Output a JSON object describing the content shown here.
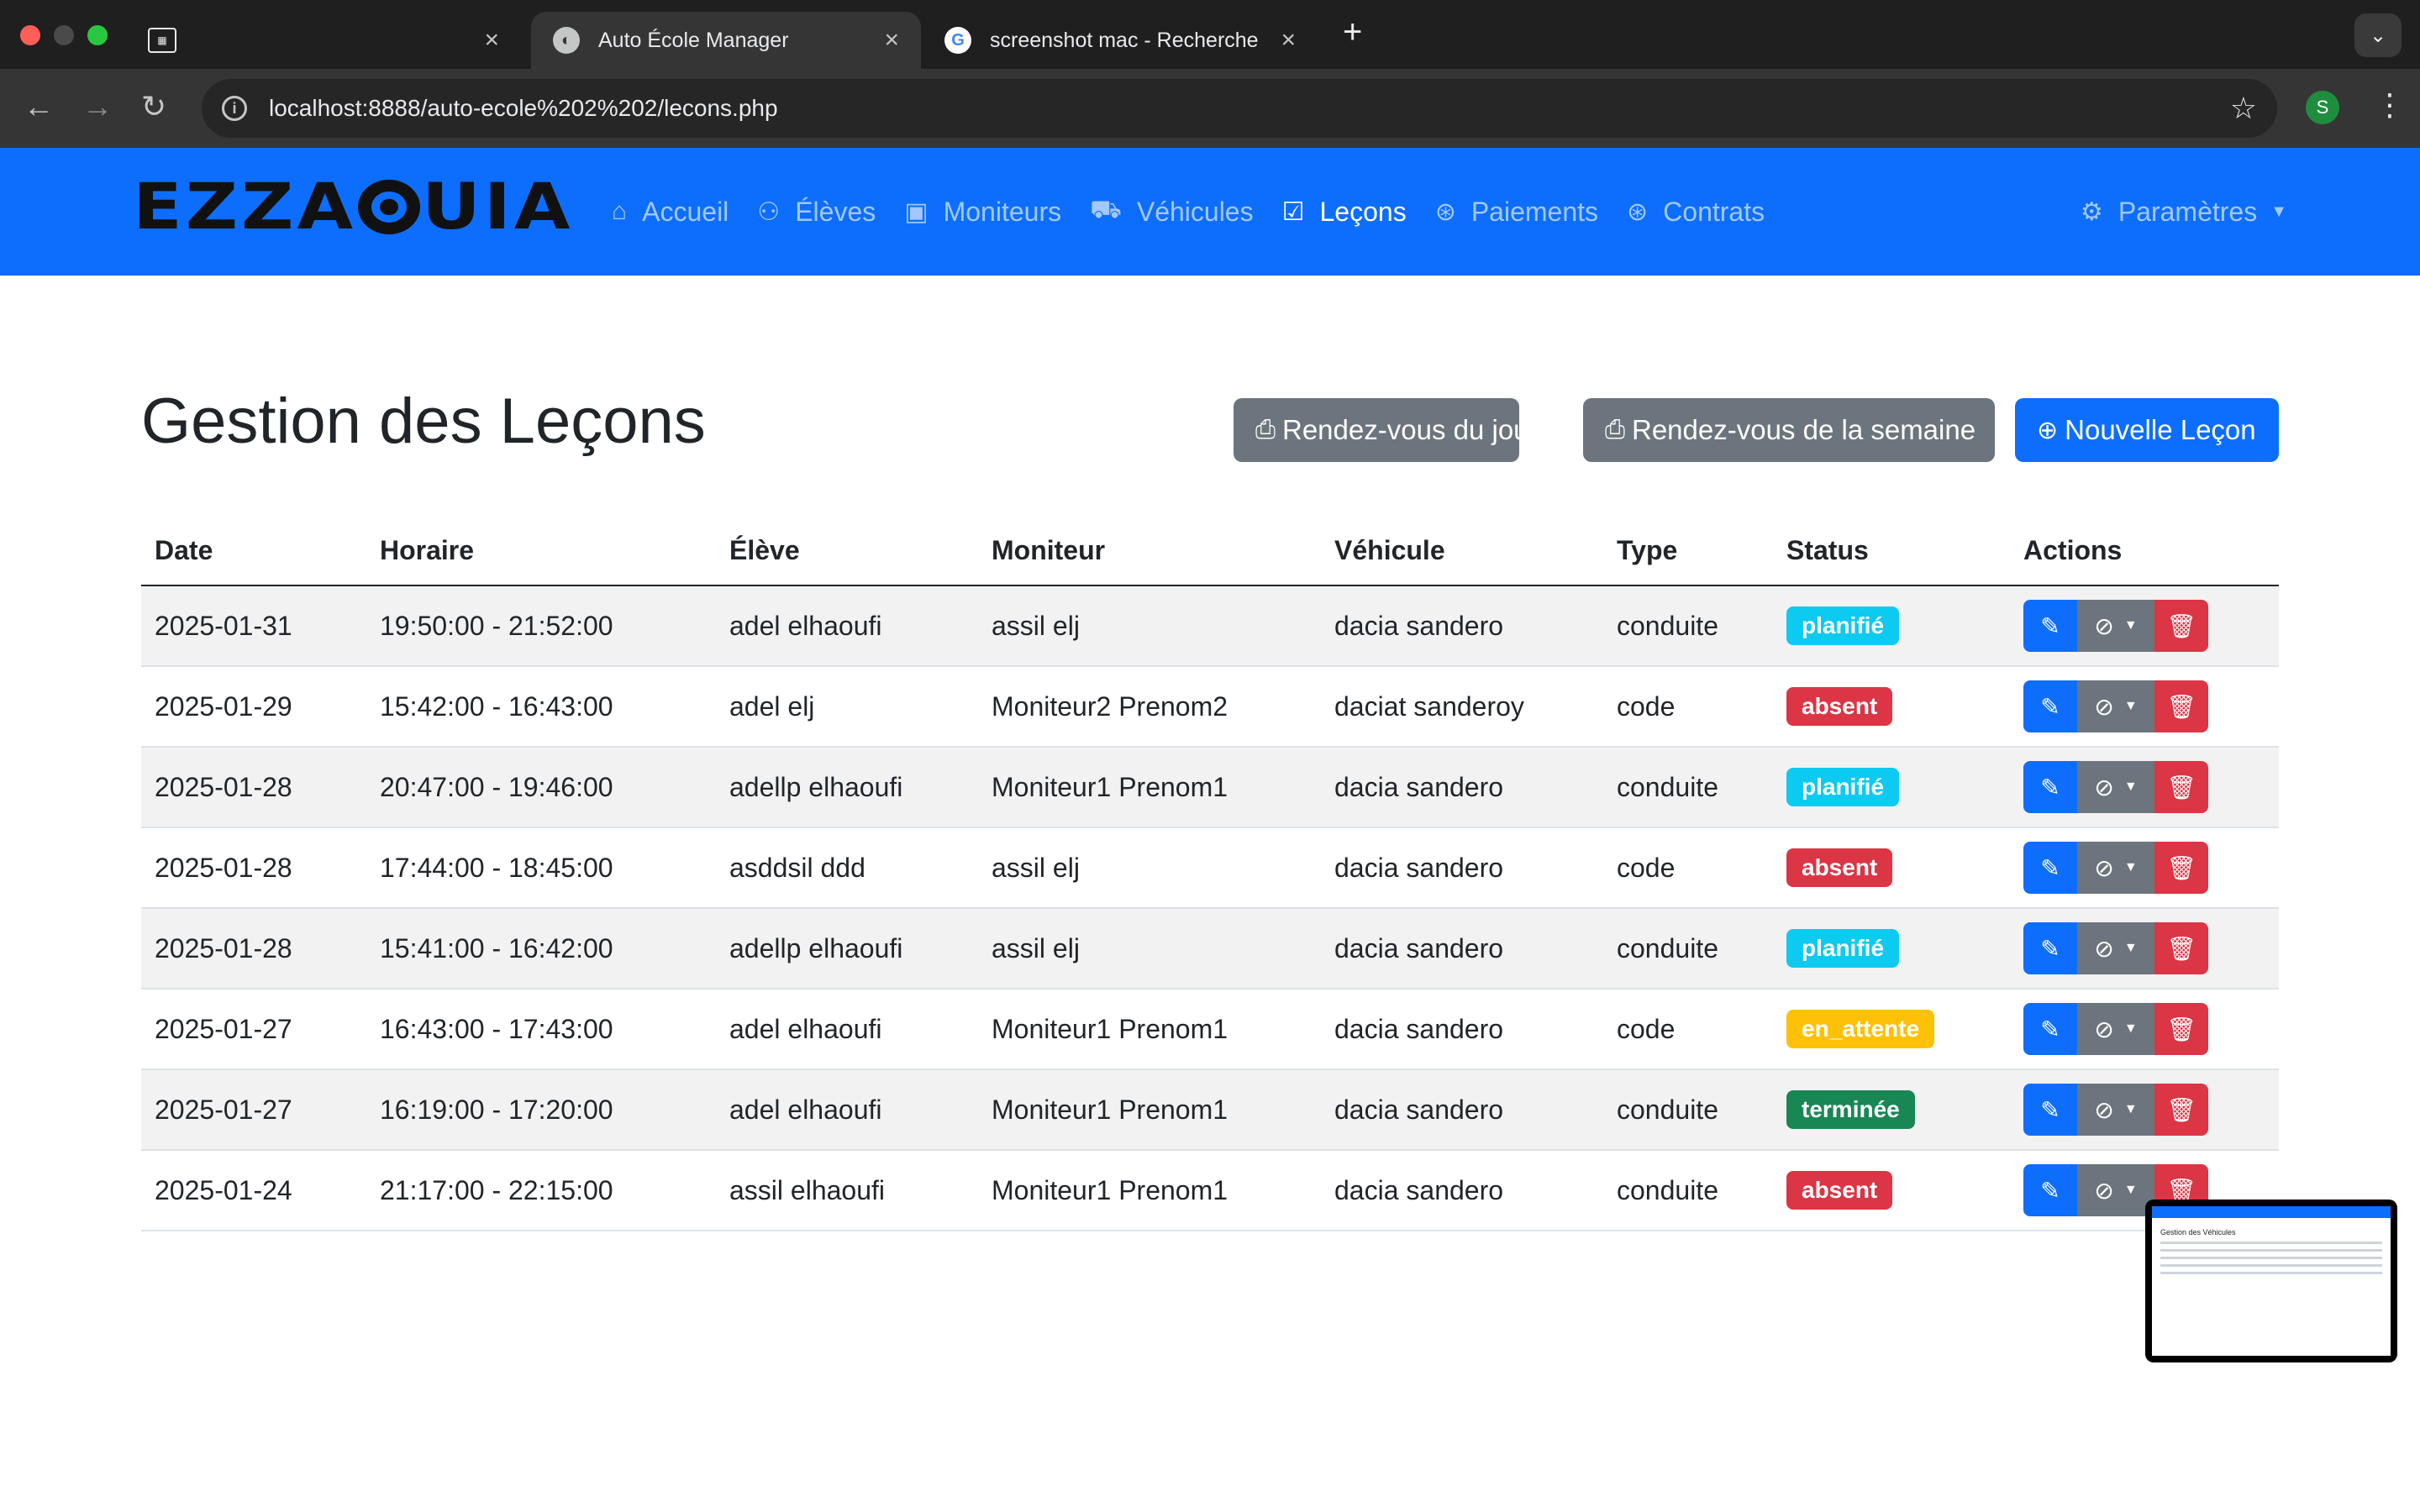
{
  "browser": {
    "tabs": [
      {
        "title": "",
        "icon": "app-icon"
      },
      {
        "title": "Auto École Manager",
        "icon": "app-favicon"
      },
      {
        "title": "screenshot mac - Recherche",
        "icon": "google-icon"
      }
    ],
    "url": "localhost:8888/auto-ecole%202%202/lecons.php",
    "profile_initial": "S"
  },
  "navbar": {
    "brand_left": "EZZA",
    "brand_right": "UIA",
    "items": [
      {
        "label": "Accueil",
        "icon": "home-icon"
      },
      {
        "label": "Élèves",
        "icon": "people-icon"
      },
      {
        "label": "Moniteurs",
        "icon": "badge-icon"
      },
      {
        "label": "Véhicules",
        "icon": "truck-icon"
      },
      {
        "label": "Leçons",
        "icon": "calendar-check-icon",
        "active": true
      },
      {
        "label": "Paiements",
        "icon": "cash-icon"
      },
      {
        "label": "Contrats",
        "icon": "contract-icon"
      }
    ],
    "settings_label": "Paramètres"
  },
  "page": {
    "title": "Gestion des Leçons",
    "buttons": {
      "today": "Rendez-vous du jour",
      "week": "Rendez-vous de la semaine",
      "new": "Nouvelle Leçon"
    }
  },
  "table": {
    "headers": [
      "Date",
      "Horaire",
      "Élève",
      "Moniteur",
      "Véhicule",
      "Type",
      "Status",
      "Actions"
    ],
    "rows": [
      {
        "date": "2025-01-31",
        "time": "19:50:00 - 21:52:00",
        "student": "adel elhaoufi",
        "instructor": "assil elj",
        "vehicle": "dacia sandero",
        "type": "conduite",
        "status": "planifié",
        "status_color": "#0dcaf0"
      },
      {
        "date": "2025-01-29",
        "time": "15:42:00 - 16:43:00",
        "student": "adel elj",
        "instructor": "Moniteur2 Prenom2",
        "vehicle": "daciat sanderoy",
        "type": "code",
        "status": "absent",
        "status_color": "#dc3545"
      },
      {
        "date": "2025-01-28",
        "time": "20:47:00 - 19:46:00",
        "student": "adellp elhaoufi",
        "instructor": "Moniteur1 Prenom1",
        "vehicle": "dacia sandero",
        "type": "conduite",
        "status": "planifié",
        "status_color": "#0dcaf0"
      },
      {
        "date": "2025-01-28",
        "time": "17:44:00 - 18:45:00",
        "student": "asddsil ddd",
        "instructor": "assil elj",
        "vehicle": "dacia sandero",
        "type": "code",
        "status": "absent",
        "status_color": "#dc3545"
      },
      {
        "date": "2025-01-28",
        "time": "15:41:00 - 16:42:00",
        "student": "adellp elhaoufi",
        "instructor": "assil elj",
        "vehicle": "dacia sandero",
        "type": "conduite",
        "status": "planifié",
        "status_color": "#0dcaf0"
      },
      {
        "date": "2025-01-27",
        "time": "16:43:00 - 17:43:00",
        "student": "adel elhaoufi",
        "instructor": "Moniteur1 Prenom1",
        "vehicle": "dacia sandero",
        "type": "code",
        "status": "en_attente",
        "status_color": "#ffc107"
      },
      {
        "date": "2025-01-27",
        "time": "16:19:00 - 17:20:00",
        "student": "adel elhaoufi",
        "instructor": "Moniteur1 Prenom1",
        "vehicle": "dacia sandero",
        "type": "conduite",
        "status": "terminée",
        "status_color": "#198754"
      },
      {
        "date": "2025-01-24",
        "time": "21:17:00 - 22:15:00",
        "student": "assil elhaoufi",
        "instructor": "Moniteur1 Prenom1",
        "vehicle": "dacia sandero",
        "type": "conduite",
        "status": "absent",
        "status_color": "#dc3545"
      }
    ]
  },
  "screenshot_preview": {
    "title": "Gestion des Véhicules"
  }
}
